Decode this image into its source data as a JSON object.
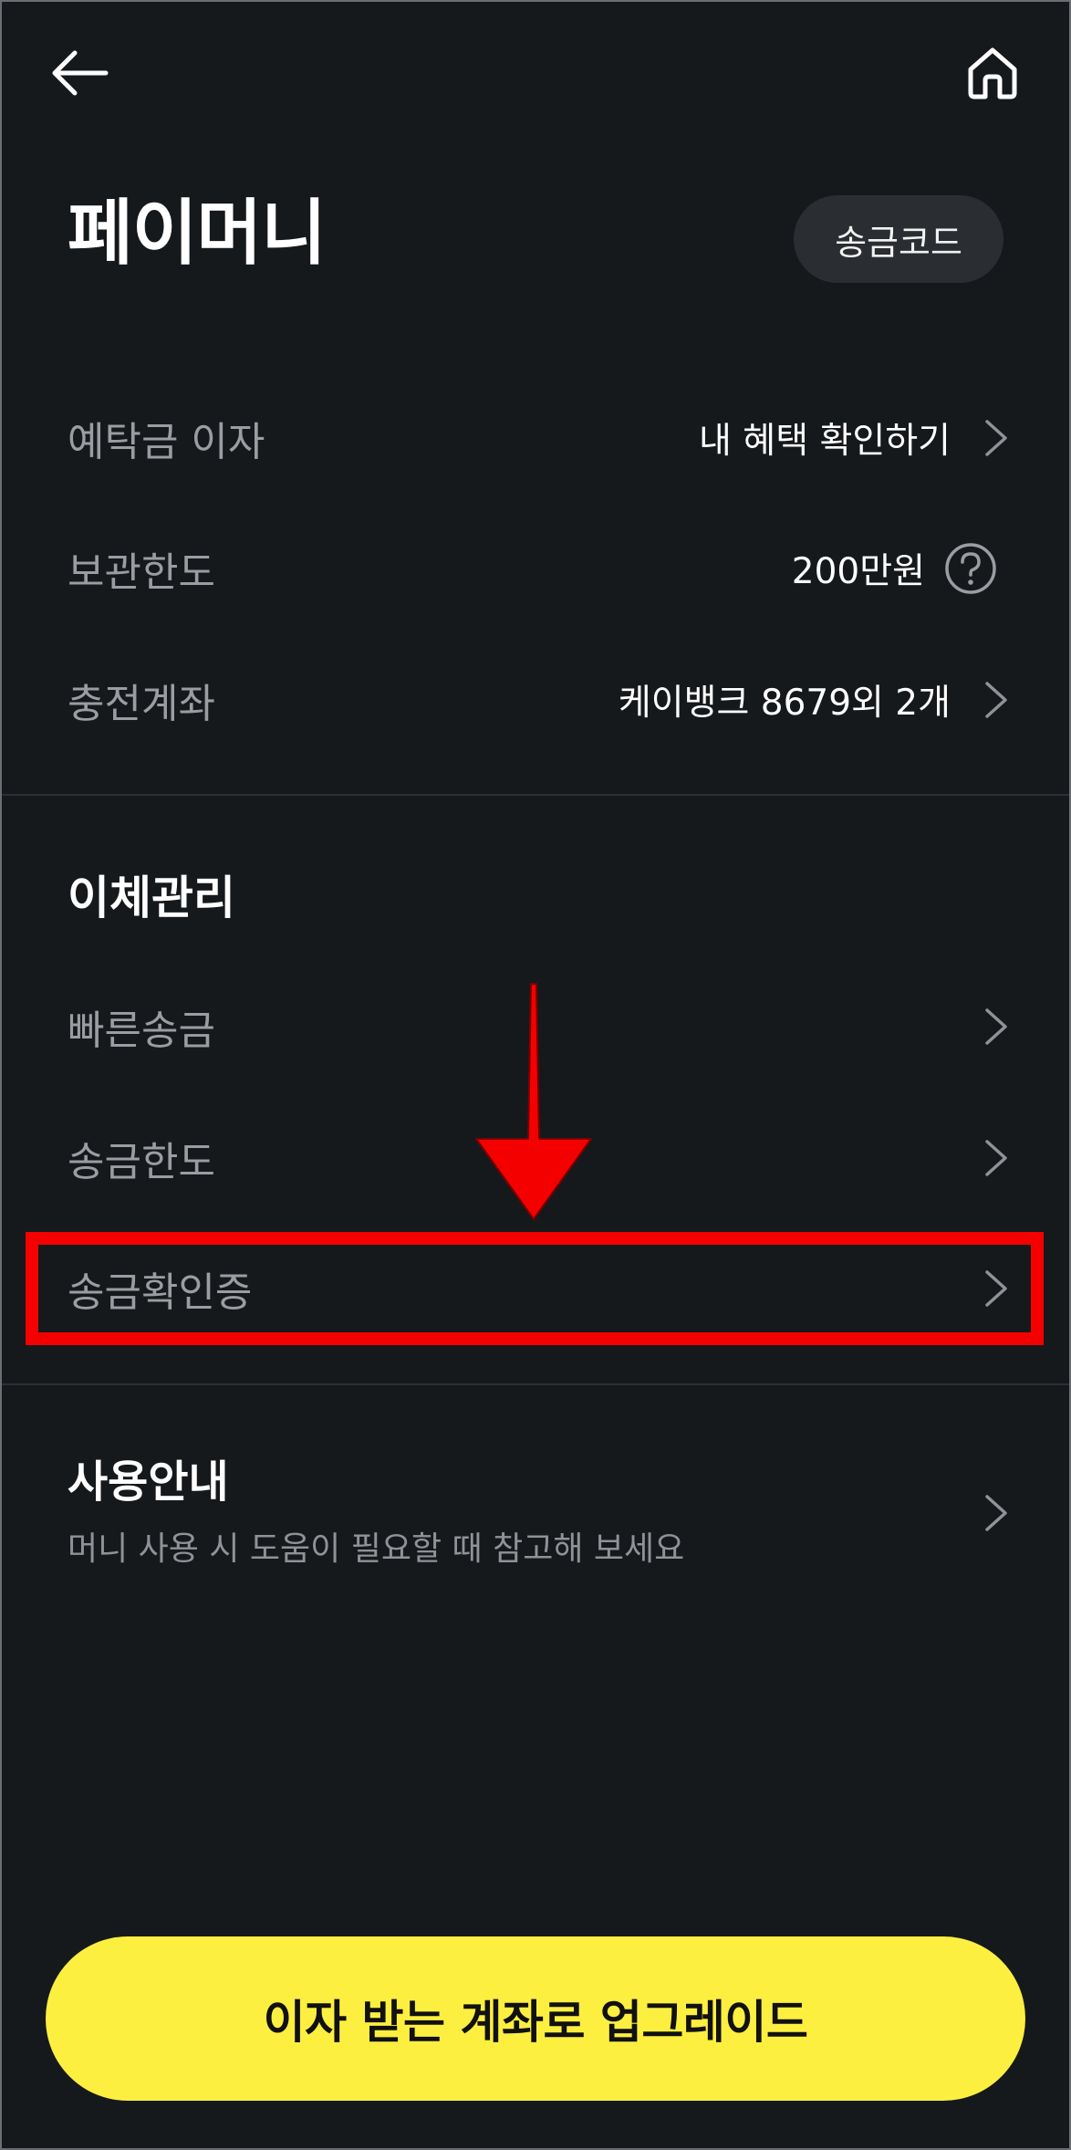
{
  "header": {
    "back_icon": "arrow-left-icon",
    "home_icon": "home-icon",
    "title": "페이머니",
    "code_button": "송금코드"
  },
  "info": {
    "interest_label": "예탁금 이자",
    "interest_value": "내 혜택 확인하기",
    "limit_label": "보관한도",
    "limit_value": "200만원",
    "account_label": "충전계좌",
    "account_value": "케이뱅크 8679외 2개"
  },
  "transfer": {
    "section_title": "이체관리",
    "items": [
      {
        "label": "빠른송금"
      },
      {
        "label": "송금한도"
      },
      {
        "label": "송금확인증"
      }
    ]
  },
  "guide": {
    "title": "사용안내",
    "subtitle": "머니 사용 시 도움이 필요할 때 참고해 보세요"
  },
  "cta": {
    "label": "이자 받는 계좌로 업그레이드"
  },
  "colors": {
    "background": "#16191c",
    "accent_yellow": "#fdef40",
    "annotation_red": "#f40000"
  }
}
